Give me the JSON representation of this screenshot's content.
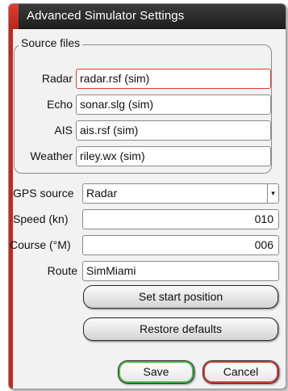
{
  "dialog": {
    "title": "Advanced Simulator Settings"
  },
  "source_files": {
    "legend": "Source files",
    "radar": {
      "label": "Radar",
      "value": "radar.rsf (sim)"
    },
    "echo": {
      "label": "Echo",
      "value": "sonar.slg (sim)"
    },
    "ais": {
      "label": "AIS",
      "value": "ais.rsf (sim)"
    },
    "weather": {
      "label": "Weather",
      "value": "riley.wx (sim)"
    }
  },
  "gps_source": {
    "label": "GPS source",
    "value": "Radar",
    "arrow": "▾"
  },
  "speed": {
    "label": "Speed (kn)",
    "value": "010"
  },
  "course": {
    "label": "Course (°M)",
    "value": "006"
  },
  "route": {
    "label": "Route",
    "value": "SimMiami"
  },
  "buttons": {
    "set_start": "Set start position",
    "restore": "Restore defaults",
    "save": "Save",
    "cancel": "Cancel"
  },
  "colors": {
    "accent_red": "#c4281f",
    "save_green": "#48b84a",
    "cancel_red": "#d8403a"
  }
}
